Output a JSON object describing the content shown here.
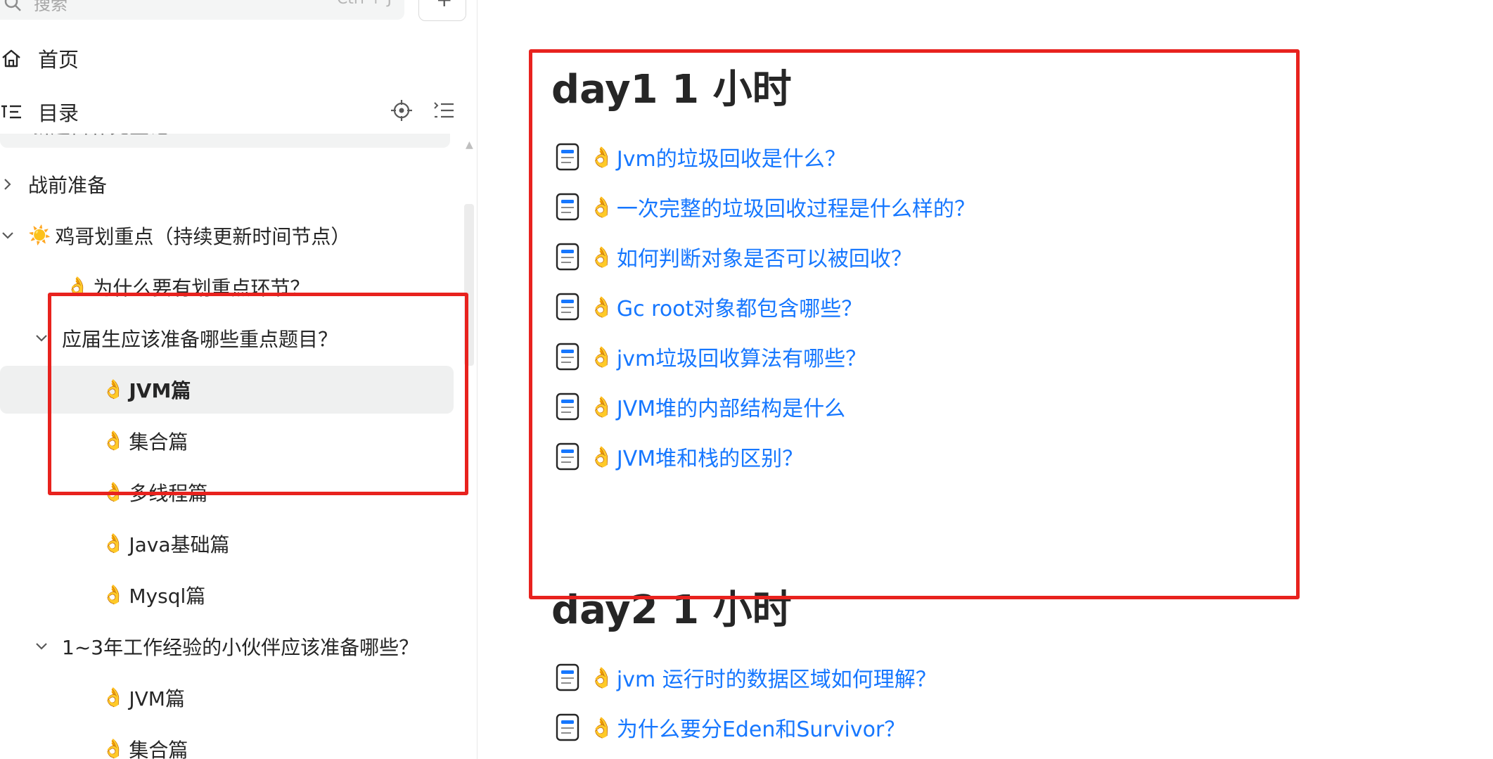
{
  "colors": {
    "link": "#1677ff",
    "text": "#262626",
    "annotation_red": "#e8221e",
    "active_bg": "#eff0f0"
  },
  "sidebar": {
    "search": {
      "placeholder": "搜索",
      "shortcut": "Ctrl + J"
    },
    "add_button_icon": "plus-icon",
    "add_label": "+",
    "home_label": "首页",
    "toc_label": "目录",
    "cut_item_label": "新题目补充登记",
    "tree": [
      {
        "label": "战前准备",
        "emoji": "",
        "collapsed": true
      },
      {
        "label": "鸡哥划重点（持续更新时间节点）",
        "emoji": "☀️",
        "expanded": true
      },
      {
        "label": "为什么要有划重点环节？",
        "emoji": "👌"
      },
      {
        "label": "应届生应该准备哪些重点题目？",
        "emoji": "",
        "expanded": true
      },
      {
        "label": "JVM篇",
        "emoji": "👌",
        "active": true
      },
      {
        "label": "集合篇",
        "emoji": "👌"
      },
      {
        "label": "多线程篇",
        "emoji": "👌"
      },
      {
        "label": "Java基础篇",
        "emoji": "👌"
      },
      {
        "label": "Mysql篇",
        "emoji": "👌"
      },
      {
        "label": "1~3年工作经验的小伙伴应该准备哪些？",
        "emoji": "",
        "expanded": true
      },
      {
        "label": "JVM篇",
        "emoji": "👌"
      },
      {
        "label": "集合篇",
        "emoji": "👌"
      }
    ]
  },
  "content": {
    "sections": [
      {
        "title": "day1 1 小时",
        "links": [
          {
            "emoji": "👌",
            "text": "Jvm的垃圾回收是什么？"
          },
          {
            "emoji": "👌",
            "text": "一次完整的垃圾回收过程是什么样的？"
          },
          {
            "emoji": "👌",
            "text": "如何判断对象是否可以被回收？"
          },
          {
            "emoji": "👌",
            "text": "Gc root对象都包含哪些？"
          },
          {
            "emoji": "👌",
            "text": "jvm垃圾回收算法有哪些？"
          },
          {
            "emoji": "👌",
            "text": "JVM堆的内部结构是什么"
          },
          {
            "emoji": "👌",
            "text": "JVM堆和栈的区别？"
          }
        ]
      },
      {
        "title": "day2 1 小时",
        "links": [
          {
            "emoji": "👌",
            "text": "jvm 运行时的数据区域如何理解？"
          },
          {
            "emoji": "👌",
            "text": "为什么要分Eden和Survivor？"
          }
        ]
      }
    ]
  }
}
